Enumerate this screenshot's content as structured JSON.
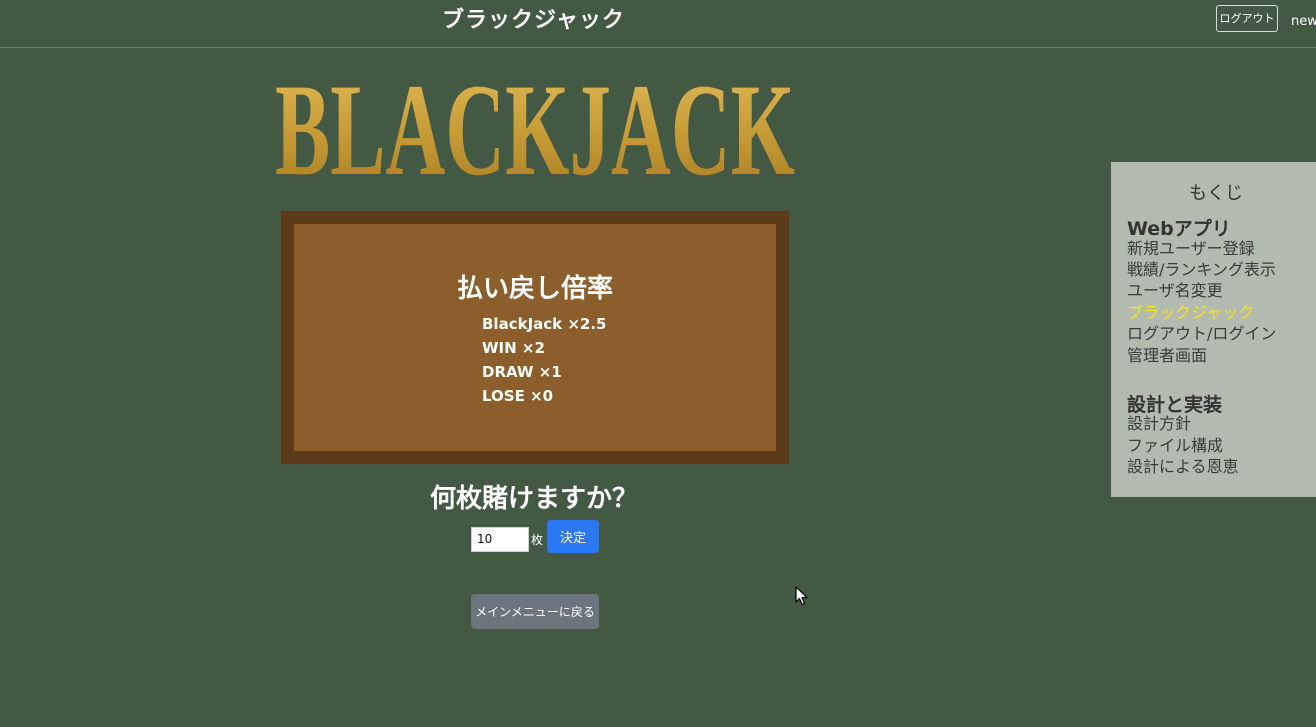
{
  "header": {
    "title": "ブラックジャック",
    "logout_label": "ログアウト",
    "username": "new"
  },
  "logo": {
    "text": "BLACKJACK",
    "color": "#c9a23f"
  },
  "payout": {
    "title": "払い戻し倍率",
    "items": [
      "BlackJack ×2.5",
      "WIN ×2",
      "DRAW ×1",
      "LOSE ×0"
    ]
  },
  "bet": {
    "question": "何枚賭けますか？",
    "input_value": "10",
    "unit": "枚",
    "submit_label": "決定"
  },
  "main_menu_label": "メインメニューに戻る",
  "toc": {
    "title": "もくじ",
    "sections": [
      {
        "heading": "Webアプリ",
        "items": [
          "新規ユーザー登録",
          "戦績/ランキング表示",
          "ユーザ名変更",
          "ブラックジャック",
          "ログアウト/ログイン",
          "管理者画面"
        ]
      },
      {
        "heading": "設計と実装",
        "items": [
          "設計方針",
          "ファイル構成",
          "設計による恩恵"
        ]
      }
    ],
    "active_item": "ブラックジャック"
  },
  "colors": {
    "background": "#445944",
    "board_frame": "#5c3a1a",
    "board_felt": "#8b5e2c",
    "primary_button": "#2b78f5",
    "secondary_button": "#6c757d",
    "toc_background": "#b3bbb0",
    "toc_active": "#f5e51b"
  }
}
